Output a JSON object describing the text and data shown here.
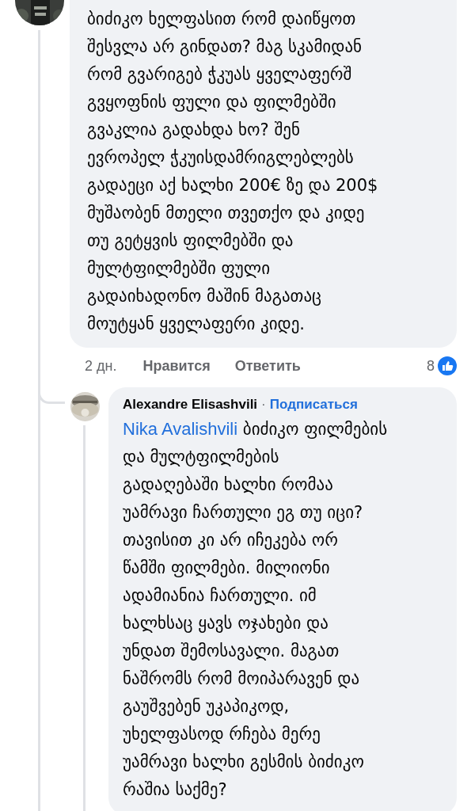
{
  "comment": {
    "text": "ბიძიკო ხელფასით რომ დაიწყოთ\nშესვლა არ გინდათ? მაგ სკამიდან\nრომ გვარიგებ ჭკუას ყველაფერშ\nგვყოფნის ფული და ფილმებში\nგვაკლია გადახდა ხო? შენ\nევროპელ ჭკუისდამრიგლებლებს\nგადაეცი აქ ხალხი 200€ ზე და 200$\nმუშაობენ მთელი თვეთქო და კიდე\nთუ გეტყვის ფილმებში და\nმულტფილმებში ფული\nგადაიხადონო მაშინ მაგათაც\nმოუტყან ყველაფერი კიდე.",
    "time": "2 дн.",
    "like_action": "Нравится",
    "reply_action": "Ответить",
    "reaction_count": "8"
  },
  "reply": {
    "author": "Alexandre Elisashvili",
    "separator": "·",
    "follow_link": "Подписаться",
    "mention": "Nika Avalishvili",
    "text": "ბიძიკო ფილმების\nდა მულტფილმების\nგადაღებაში ხალხი რომაა\nუამრავი ჩართული ეგ თუ იცი?\nთავისით კი არ იჩეკება ორ\nწამში ფილმები. მილიონი\nადამიანია ჩართული. იმ\nხალხსაც ყავს ოჯახები და\nუნდათ შემოსავალი. მაგათ\nნაშრომს რომ მოიპარავენ და\nგაუშვებენ უკაპიკოდ,\nუხელფასოდ რჩება მერე\nუამრავი ხალხი გესმის ბიძიკო\nრაშია საქმე?"
  }
}
